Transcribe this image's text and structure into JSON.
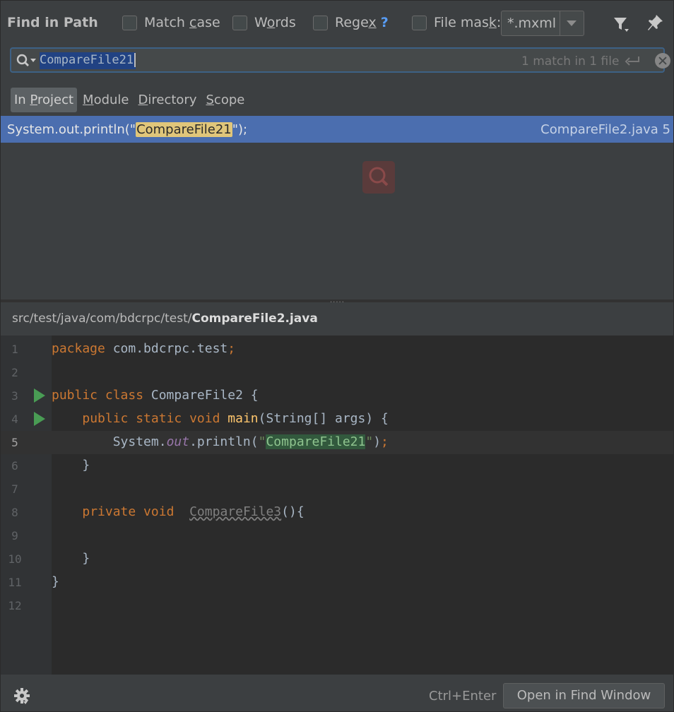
{
  "header": {
    "title": "Find in Path",
    "options": [
      {
        "pre": "Match ",
        "u": "c",
        "post": "ase"
      },
      {
        "pre": "W",
        "u": "o",
        "post": "rds"
      },
      {
        "pre": "Rege",
        "u": "x",
        "post": ""
      },
      {
        "pre": "File mas",
        "u": "k",
        "post": ":"
      }
    ],
    "regex_help": "?",
    "file_mask_value": "*.mxml"
  },
  "search": {
    "query": "CompareFile21",
    "match_count": "1 match in 1 file"
  },
  "scope_tabs": [
    {
      "pre": "In ",
      "u": "P",
      "post": "roject"
    },
    {
      "pre": "",
      "u": "M",
      "post": "odule"
    },
    {
      "pre": "",
      "u": "D",
      "post": "irectory"
    },
    {
      "pre": "",
      "u": "S",
      "post": "cope"
    }
  ],
  "result": {
    "code_pre": "System.out.println(\"",
    "code_match": "CompareFile21",
    "code_post": "\");",
    "file": "CompareFile2.java 5"
  },
  "preview": {
    "path_dir": "src/test/java/com/bdcrpc/test/",
    "path_file": "CompareFile2.java"
  },
  "editor_lines": [
    "1",
    "2",
    "3",
    "4",
    "5",
    "6",
    "7",
    "8",
    "9",
    "10",
    "11",
    "12"
  ],
  "code": {
    "l1_kw": "package",
    "l1_rest": " com.bdcrpc.test",
    "l1_semi": ";",
    "l3_kw": "public class",
    "l3_rest": " CompareFile2 {",
    "l4_indent": "    ",
    "l4_kw": "public static void",
    "l4_fn": "main",
    "l4_rest": "(String[] args) {",
    "l5_indent": "        ",
    "l5_a": "System.",
    "l5_static": "out",
    "l5_b": ".println(",
    "l5_q1": "\"",
    "l5_str": "CompareFile21",
    "l5_q2": "\"",
    "l5_c": ")",
    "l5_semi": ";",
    "l6": "    }",
    "l8_indent": "    ",
    "l8_kw": "private void",
    "l8_sp": "  ",
    "l8_unused": "CompareFile3",
    "l8_rest": "(){",
    "l10": "    }",
    "l11": "}"
  },
  "footer": {
    "shortcut": "Ctrl+Enter",
    "open_button": "Open in Find Window"
  },
  "colors": {
    "selection": "#4b6eaf",
    "match_highlight": "#e0c67a",
    "run_green": "#499c54"
  },
  "icons": [
    "filter-icon",
    "pin-icon",
    "search-icon",
    "enter-icon",
    "clear-icon",
    "loading-icon",
    "run-icon",
    "gear-icon"
  ]
}
